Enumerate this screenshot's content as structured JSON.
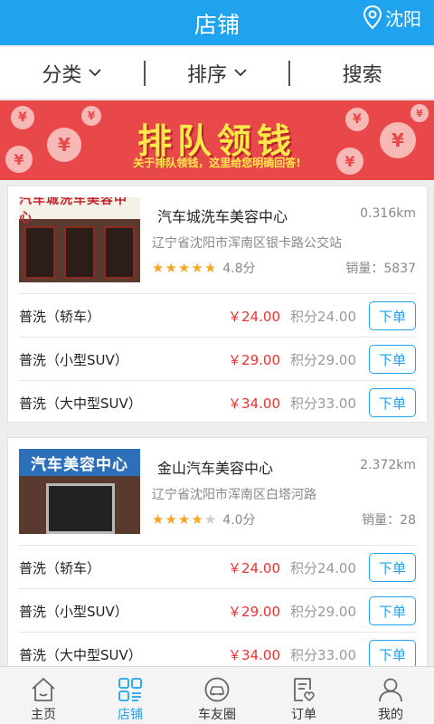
{
  "header": {
    "title": "店铺",
    "city": "沈阳"
  },
  "filters": {
    "category": "分类",
    "sort": "排序",
    "search": "搜索"
  },
  "banner": {
    "title": "排队领钱",
    "subtitle": "关于排队领钱，这里给您明确回答!"
  },
  "shops": [
    {
      "image_sign": "汽车城洗车美容中心",
      "name": "汽车城洗车美容中心",
      "distance": "0.316km",
      "address": "辽宁省沈阳市浑南区银卡路公交站",
      "rating": 4.8,
      "rating_text": "4.8分",
      "sales": "销量：5837",
      "services": [
        {
          "name": "普洗（轿车）",
          "price": "￥24.00",
          "points": "积分24.00",
          "button": "下单"
        },
        {
          "name": "普洗（小型SUV）",
          "price": "￥29.00",
          "points": "积分29.00",
          "button": "下单"
        },
        {
          "name": "普洗（大中型SUV）",
          "price": "￥34.00",
          "points": "积分33.00",
          "button": "下单"
        }
      ]
    },
    {
      "image_sign": "汽车美容中心",
      "name": "金山汽车美容中心",
      "distance": "2.372km",
      "address": "辽宁省沈阳市浑南区白塔河路",
      "rating": 4.0,
      "rating_text": "4.0分",
      "sales": "销量：28",
      "services": [
        {
          "name": "普洗（轿车）",
          "price": "￥24.00",
          "points": "积分24.00",
          "button": "下单"
        },
        {
          "name": "普洗（小型SUV）",
          "price": "￥29.00",
          "points": "积分29.00",
          "button": "下单"
        },
        {
          "name": "普洗（大中型SUV）",
          "price": "￥34.00",
          "points": "积分33.00",
          "button": "下单"
        }
      ]
    }
  ],
  "tabs": [
    {
      "label": "主页",
      "icon": "home-icon",
      "active": false
    },
    {
      "label": "店铺",
      "icon": "shop-icon",
      "active": true
    },
    {
      "label": "车友圈",
      "icon": "car-circle-icon",
      "active": false
    },
    {
      "label": "订单",
      "icon": "order-icon",
      "active": false
    },
    {
      "label": "我的",
      "icon": "user-icon",
      "active": false
    }
  ],
  "colors": {
    "brand": "#1fa3ee",
    "price": "#e8332f",
    "star": "#f5a623",
    "banner_bg": "#e9484a",
    "banner_text": "#fde84a"
  }
}
